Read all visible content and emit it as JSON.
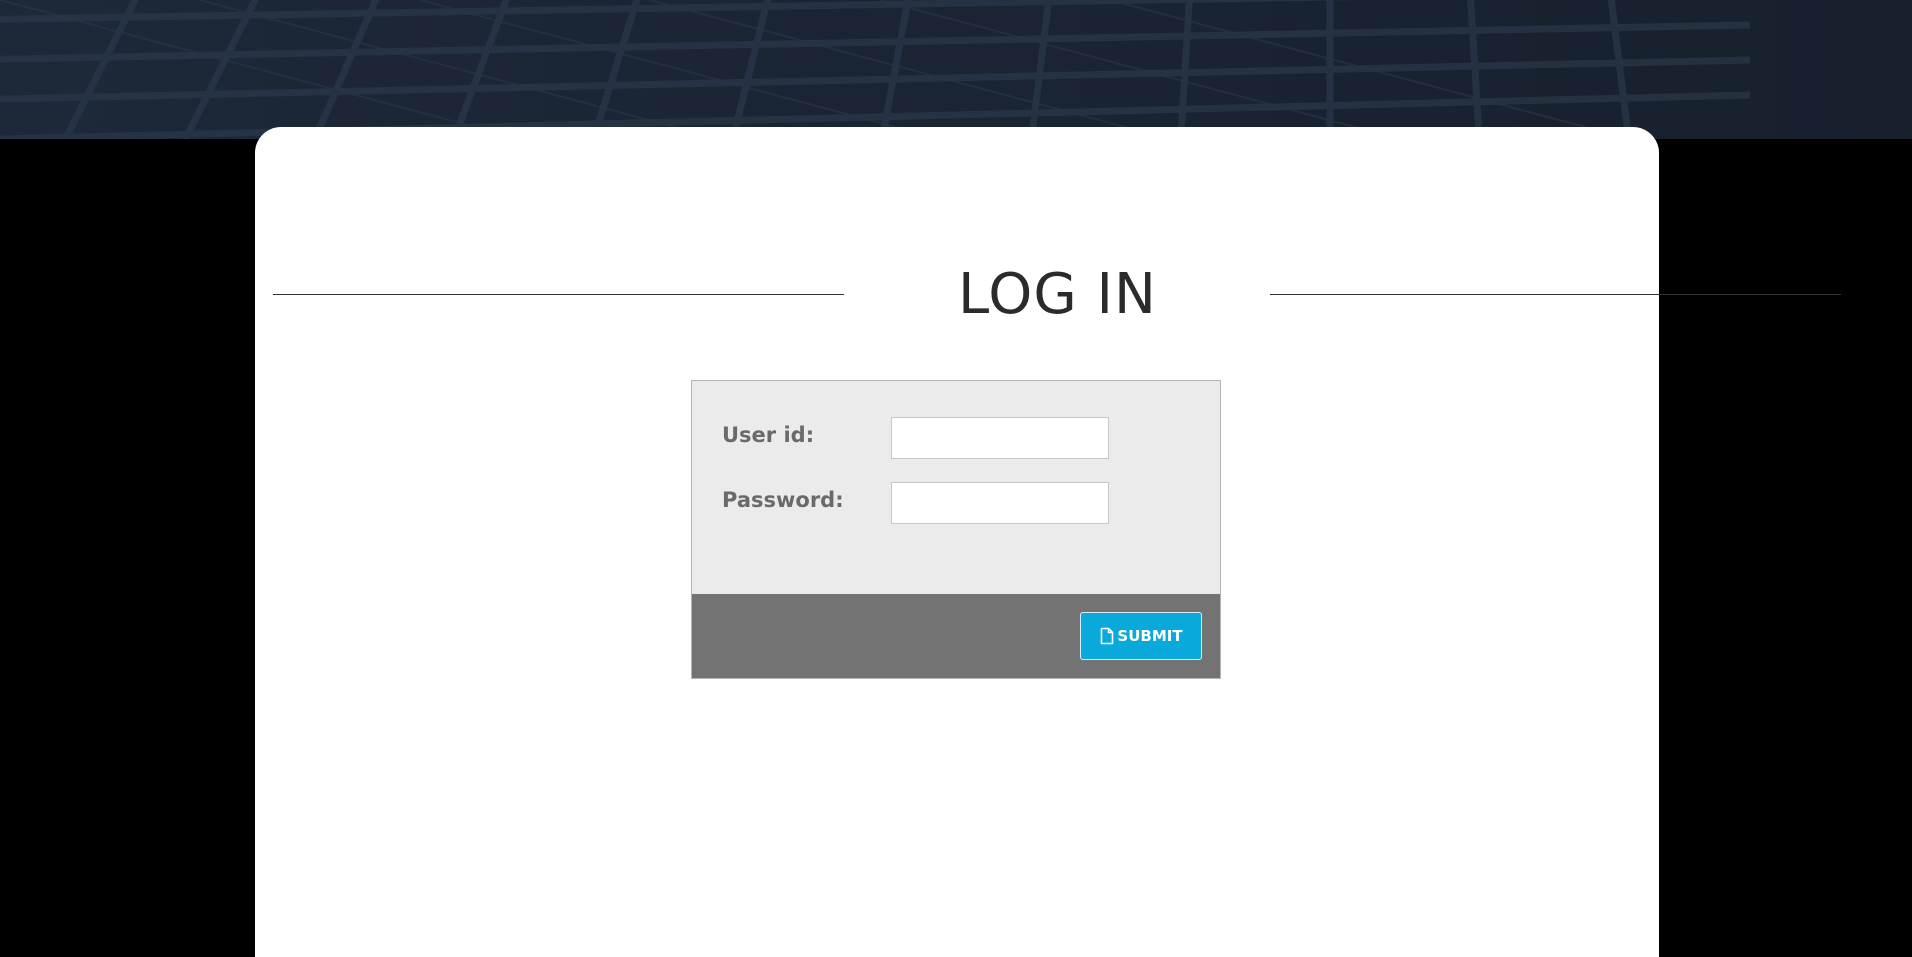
{
  "page": {
    "heading": "LOG IN"
  },
  "form": {
    "user_id_label": "User id:",
    "user_id_value": "",
    "password_label": "Password:",
    "password_value": "",
    "submit_label": "SUBMIT",
    "submit_icon": "file-icon"
  },
  "colors": {
    "banner": "#1d2838",
    "background": "#000000",
    "card": "#ffffff",
    "form_panel": "#ebebeb",
    "form_footer": "#737373",
    "submit_button": "#0aa9dc",
    "label_text": "#6a6a6a",
    "heading_text": "#2b2b2b"
  }
}
